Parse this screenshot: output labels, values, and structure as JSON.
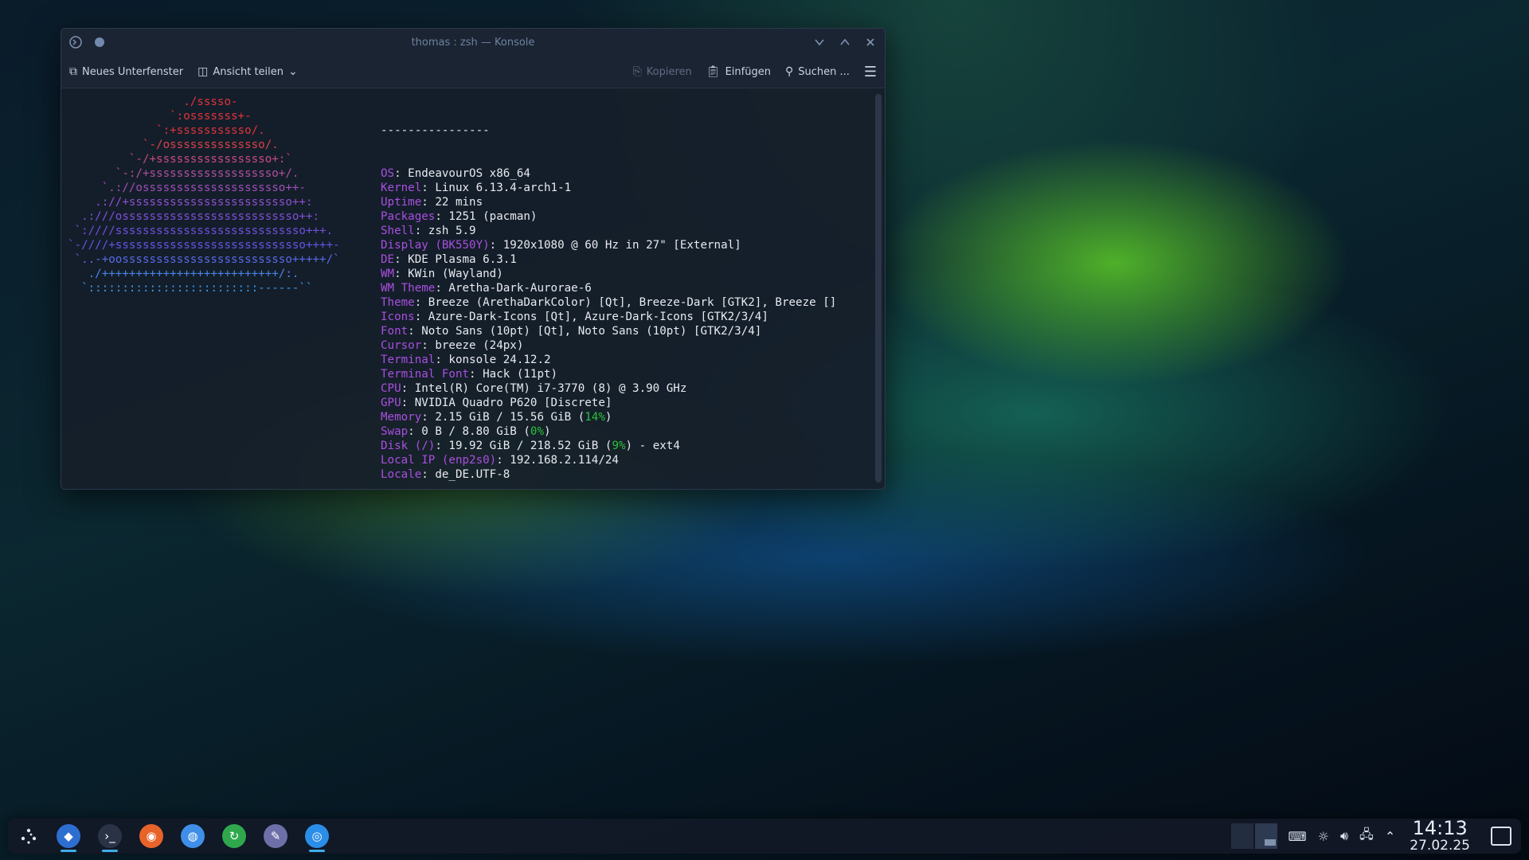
{
  "window": {
    "title": "thomas : zsh — Konsole",
    "toolbar": {
      "new_tab": "Neues Unterfenster",
      "split_view": "Ansicht teilen",
      "copy": "Kopieren",
      "paste": "Einfügen",
      "search": "Suchen ..."
    }
  },
  "terminal": {
    "ascii_art": [
      "                 ./sssso-",
      "               `:osssssss+-",
      "             `:+sssssssssso/.",
      "           `-/ossssssssssssso/.",
      "         `-/+sssssssssssssssso+:`",
      "       `-:/+sssssssssssssssssso+/.",
      "     `.://osssssssssssssssssssso++-",
      "    .://+ssssssssssssssssssssssso++:",
      "  .:///ossssssssssssssssssssssssso++:",
      " `:////ssssssssssssssssssssssssssso+++.",
      "`-////+ssssssssssssssssssssssssssso++++-",
      " `..-+oosssssssssssssssssssssssso+++++/`",
      "   ./++++++++++++++++++++++++++/:.",
      "  `:::::::::::::::::::::::::------``"
    ],
    "separator": "----------------",
    "info": [
      {
        "key": "OS",
        "value": ": EndeavourOS x86_64"
      },
      {
        "key": "Kernel",
        "value": ": Linux 6.13.4-arch1-1"
      },
      {
        "key": "Uptime",
        "value": ": 22 mins"
      },
      {
        "key": "Packages",
        "value": ": 1251 (pacman)"
      },
      {
        "key": "Shell",
        "value": ": zsh 5.9"
      },
      {
        "key": "Display (BK550Y)",
        "value": ": 1920x1080 @ 60 Hz in 27\" [External]"
      },
      {
        "key": "DE",
        "value": ": KDE Plasma 6.3.1"
      },
      {
        "key": "WM",
        "value": ": KWin (Wayland)"
      },
      {
        "key": "WM Theme",
        "value": ": Aretha-Dark-Aurorae-6"
      },
      {
        "key": "Theme",
        "value": ": Breeze (ArethaDarkColor) [Qt], Breeze-Dark [GTK2], Breeze []"
      },
      {
        "key": "Icons",
        "value": ": Azure-Dark-Icons [Qt], Azure-Dark-Icons [GTK2/3/4]"
      },
      {
        "key": "Font",
        "value": ": Noto Sans (10pt) [Qt], Noto Sans (10pt) [GTK2/3/4]"
      },
      {
        "key": "Cursor",
        "value": ": breeze (24px)"
      },
      {
        "key": "Terminal",
        "value": ": konsole 24.12.2"
      },
      {
        "key": "Terminal Font",
        "value": ": Hack (11pt)"
      },
      {
        "key": "CPU",
        "value": ": Intel(R) Core(TM) i7-3770 (8) @ 3.90 GHz"
      },
      {
        "key": "GPU",
        "value": ": NVIDIA Quadro P620 [Discrete]"
      }
    ],
    "memory": {
      "key": "Memory",
      "before": ": 2.15 GiB / 15.56 GiB (",
      "pct": "14%",
      "after": ")"
    },
    "swap": {
      "key": "Swap",
      "before": ": 0 B / 8.80 GiB (",
      "pct": "0%",
      "after": ")"
    },
    "disk": {
      "key": "Disk (/)",
      "before": ": 19.92 GiB / 218.52 GiB (",
      "pct": "9%",
      "after": ") - ext4"
    },
    "local_ip": {
      "key": "Local IP (enp2s0)",
      "value": ": 192.168.2.114/24"
    },
    "locale": {
      "key": "Locale",
      "value": ": de_DE.UTF-8"
    },
    "palette_top": [
      "#1d2330",
      "#e8262e",
      "#21c43a",
      "#f07d15",
      "#2a8ee8",
      "#9b4fc9",
      "#1aa88d",
      "#ffffff"
    ],
    "palette_bottom": [
      "#7a7e86",
      "#c7282e",
      "#2fd46a",
      "#f5a73a",
      "#4aa8ee",
      "#a45bd0",
      "#24b89b",
      "#ffffff"
    ],
    "prompt_dir": "~",
    "prompt_ok": "✔"
  },
  "taskbar": {
    "clock_time": "14:13",
    "clock_date": "27.02.25",
    "apps": [
      {
        "icon": "kde-discover-icon",
        "color": "#2d6fd1"
      },
      {
        "icon": "konsole-icon",
        "color": "#2a3346"
      },
      {
        "icon": "firefox-icon",
        "color": "#e8632a"
      },
      {
        "icon": "browser-icon",
        "color": "#3f8fe8"
      },
      {
        "icon": "updater-icon",
        "color": "#2fa84d"
      },
      {
        "icon": "settings-icon",
        "color": "#6d6fa8"
      },
      {
        "icon": "app-icon",
        "color": "#2a8ee8"
      }
    ]
  }
}
